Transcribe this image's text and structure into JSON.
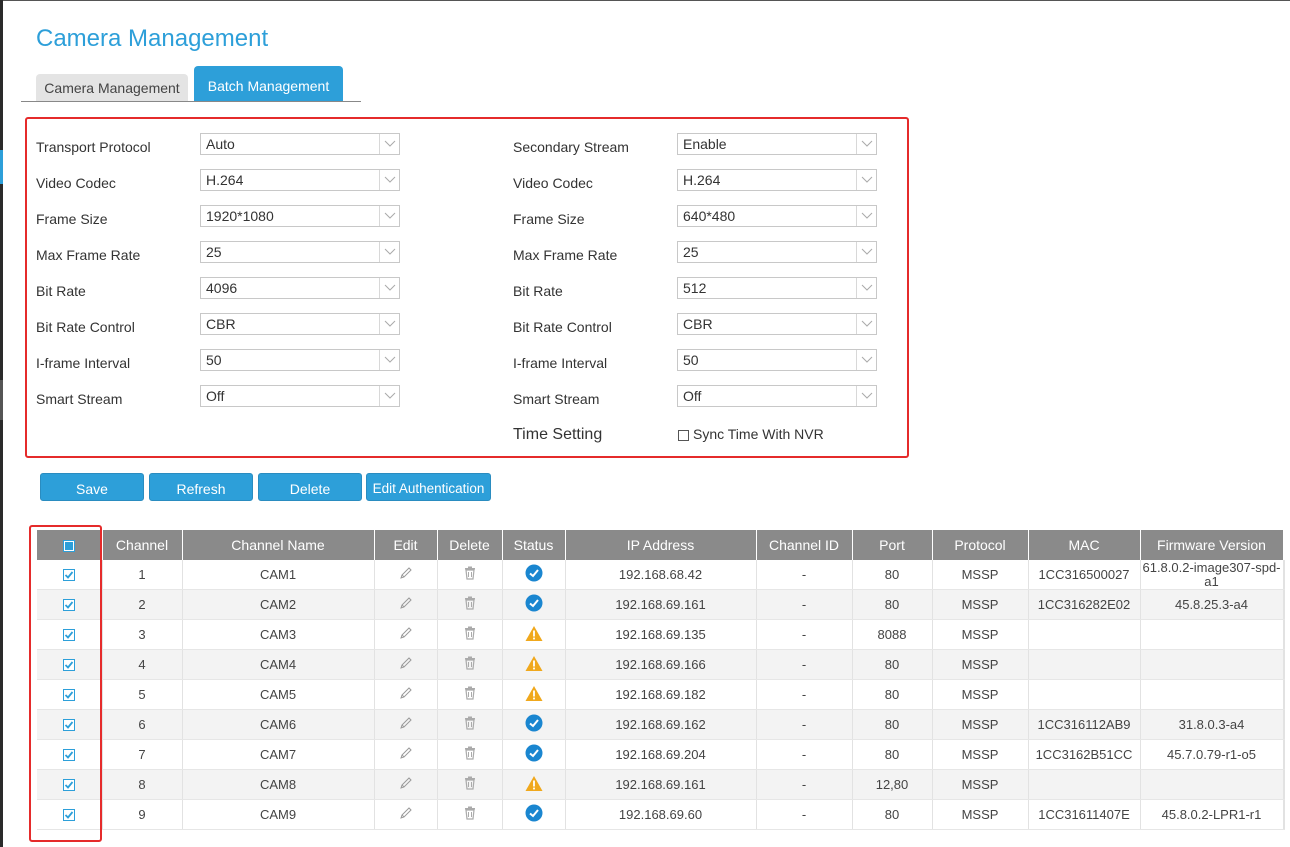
{
  "page": {
    "title": "Camera Management"
  },
  "tabs": [
    {
      "label": "Camera Management",
      "active": false
    },
    {
      "label": "Batch Management",
      "active": true
    }
  ],
  "settings": {
    "left": [
      {
        "label": "Transport Protocol",
        "value": "Auto"
      },
      {
        "label": "Video Codec",
        "value": "H.264"
      },
      {
        "label": "Frame Size",
        "value": "1920*1080"
      },
      {
        "label": "Max Frame Rate",
        "value": "25"
      },
      {
        "label": "Bit Rate",
        "value": "4096"
      },
      {
        "label": "Bit Rate Control",
        "value": "CBR"
      },
      {
        "label": "I-frame Interval",
        "value": "50"
      },
      {
        "label": "Smart Stream",
        "value": "Off"
      }
    ],
    "right": [
      {
        "label": "Secondary Stream",
        "value": "Enable"
      },
      {
        "label": "Video Codec",
        "value": "H.264"
      },
      {
        "label": "Frame Size",
        "value": "640*480"
      },
      {
        "label": "Max Frame Rate",
        "value": "25"
      },
      {
        "label": "Bit Rate",
        "value": "512"
      },
      {
        "label": "Bit Rate Control",
        "value": "CBR"
      },
      {
        "label": "I-frame Interval",
        "value": "50"
      },
      {
        "label": "Smart Stream",
        "value": "Off"
      }
    ],
    "time_setting": {
      "label": "Time Setting",
      "checkbox_label": "Sync Time With NVR",
      "checked": false
    }
  },
  "buttons": {
    "save": "Save",
    "refresh": "Refresh",
    "delete": "Delete",
    "edit_auth": "Edit Authentication"
  },
  "table": {
    "headers": [
      "Channel",
      "Channel Name",
      "Edit",
      "Delete",
      "Status",
      "IP Address",
      "Channel ID",
      "Port",
      "Protocol",
      "MAC",
      "Firmware Version"
    ],
    "rows": [
      {
        "channel": "1",
        "name": "CAM1",
        "status": "ok",
        "ip": "192.168.68.42",
        "channel_id": "-",
        "port": "80",
        "protocol": "MSSP",
        "mac": "1CC316500027",
        "firmware": "61.8.0.2-image307-spd-a1",
        "checked": true
      },
      {
        "channel": "2",
        "name": "CAM2",
        "status": "ok",
        "ip": "192.168.69.161",
        "channel_id": "-",
        "port": "80",
        "protocol": "MSSP",
        "mac": "1CC316282E02",
        "firmware": "45.8.25.3-a4",
        "checked": true
      },
      {
        "channel": "3",
        "name": "CAM3",
        "status": "warning",
        "ip": "192.168.69.135",
        "channel_id": "-",
        "port": "8088",
        "protocol": "MSSP",
        "mac": "",
        "firmware": "",
        "checked": true
      },
      {
        "channel": "4",
        "name": "CAM4",
        "status": "warning",
        "ip": "192.168.69.166",
        "channel_id": "-",
        "port": "80",
        "protocol": "MSSP",
        "mac": "",
        "firmware": "",
        "checked": true
      },
      {
        "channel": "5",
        "name": "CAM5",
        "status": "warning",
        "ip": "192.168.69.182",
        "channel_id": "-",
        "port": "80",
        "protocol": "MSSP",
        "mac": "",
        "firmware": "",
        "checked": true
      },
      {
        "channel": "6",
        "name": "CAM6",
        "status": "ok",
        "ip": "192.168.69.162",
        "channel_id": "-",
        "port": "80",
        "protocol": "MSSP",
        "mac": "1CC316112AB9",
        "firmware": "31.8.0.3-a4",
        "checked": true
      },
      {
        "channel": "7",
        "name": "CAM7",
        "status": "ok",
        "ip": "192.168.69.204",
        "channel_id": "-",
        "port": "80",
        "protocol": "MSSP",
        "mac": "1CC3162B51CC",
        "firmware": "45.7.0.79-r1-o5",
        "checked": true
      },
      {
        "channel": "8",
        "name": "CAM8",
        "status": "warning",
        "ip": "192.168.69.161",
        "channel_id": "-",
        "port": "12,80",
        "protocol": "MSSP",
        "mac": "",
        "firmware": "",
        "checked": true
      },
      {
        "channel": "9",
        "name": "CAM9",
        "status": "ok",
        "ip": "192.168.69.60",
        "channel_id": "-",
        "port": "80",
        "protocol": "MSSP",
        "mac": "1CC31611407E",
        "firmware": "45.8.0.2-LPR1-r1",
        "checked": true
      }
    ]
  },
  "colors": {
    "accent": "#2d9fd9",
    "highlight_border": "#e52b2b",
    "header_bg": "#8a8a8a",
    "warning": "#f0a81c"
  }
}
